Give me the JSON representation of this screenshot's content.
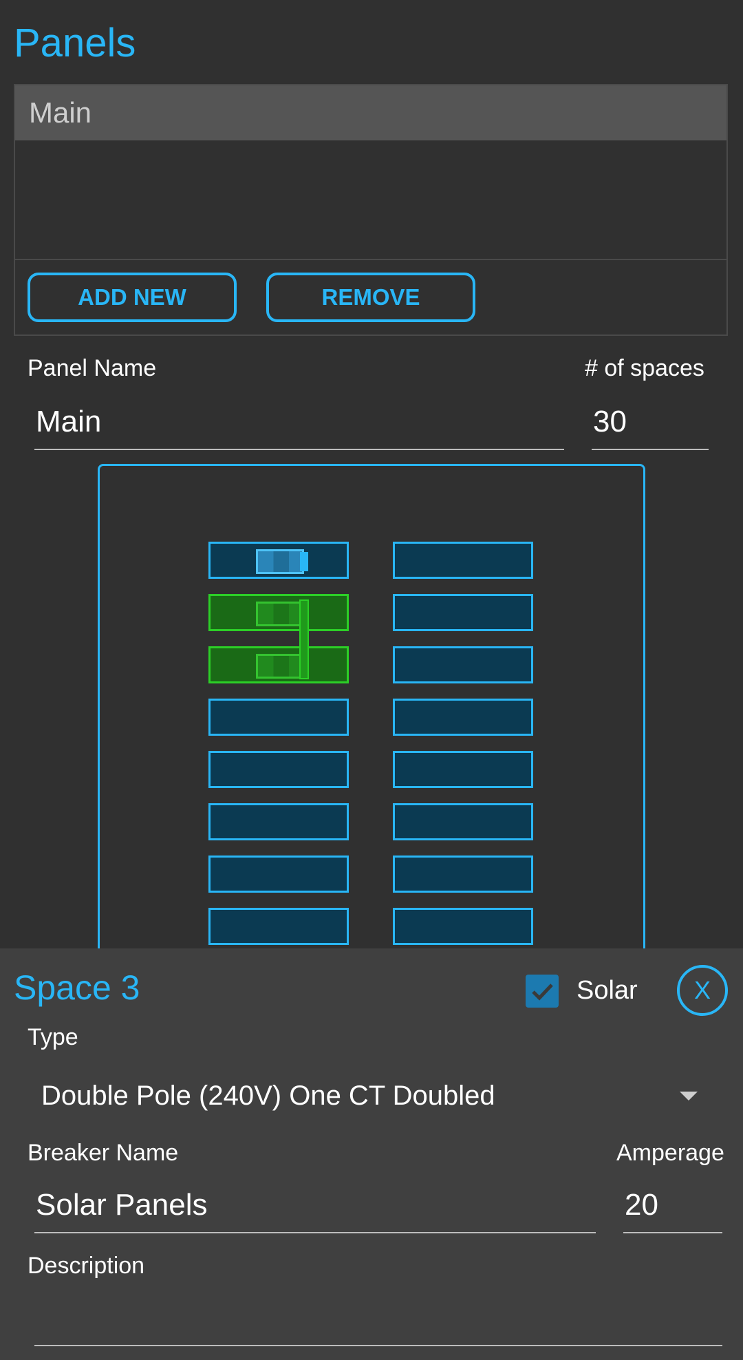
{
  "header": {
    "title": "Panels"
  },
  "panel_list": {
    "items": [
      "Main"
    ],
    "add_label": "ADD NEW",
    "remove_label": "REMOVE"
  },
  "panel_form": {
    "name_label": "Panel Name",
    "name_value": "Main",
    "spaces_label": "# of spaces",
    "spaces_value": "30"
  },
  "breaker_box": {
    "colors": {
      "empty": "#0b3a52",
      "empty_border": "#29b6f6",
      "solar": "#1a6a16",
      "solar_border": "#2ccf27"
    },
    "visible_rows": 8,
    "single_pole_in_row_1": "left",
    "double_pole_solar_rows": [
      2,
      3
    ]
  },
  "space_sheet": {
    "title": "Space 3",
    "solar_label": "Solar",
    "solar_checked": true,
    "close_label": "X",
    "type_label": "Type",
    "type_value": "Double Pole (240V) One CT Doubled",
    "breaker_name_label": "Breaker Name",
    "breaker_name_value": "Solar Panels",
    "amperage_label": "Amperage",
    "amperage_value": "20",
    "description_label": "Description",
    "description_value": ""
  },
  "icons": {
    "checkbox": "check-icon",
    "dropdown": "chevron-down-icon"
  },
  "theme": {
    "accent": "#29b6f6",
    "background": "#303030",
    "sheet_background": "#404040"
  }
}
